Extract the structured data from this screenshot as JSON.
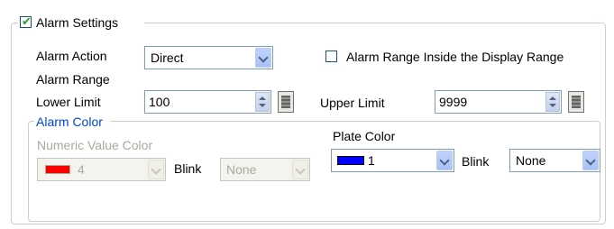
{
  "alarm_settings": {
    "title": "Alarm Settings",
    "enabled": true,
    "alarm_action_label": "Alarm Action",
    "alarm_action_value": "Direct",
    "alarm_range_label": "Alarm Range",
    "inside_display_range_label": "Alarm Range Inside the Display Range",
    "inside_display_range_checked": false,
    "lower_limit_label": "Lower Limit",
    "lower_limit_value": "100",
    "upper_limit_label": "Upper Limit",
    "upper_limit_value": "9999"
  },
  "alarm_color": {
    "title": "Alarm Color",
    "numeric_value_color_label": "Numeric Value Color",
    "numeric_value_color_value": "4",
    "numeric_value_color_swatch": "#ff0000",
    "numeric_blink_label": "Blink",
    "numeric_blink_value": "None",
    "plate_color_label": "Plate Color",
    "plate_color_value": "1",
    "plate_color_swatch": "#0000ff",
    "plate_blink_label": "Blink",
    "plate_blink_value": "None"
  },
  "colors": {
    "group_title_blue": "#0046d5",
    "check_green": "#21a121",
    "disabled_text": "#a9a99f"
  }
}
